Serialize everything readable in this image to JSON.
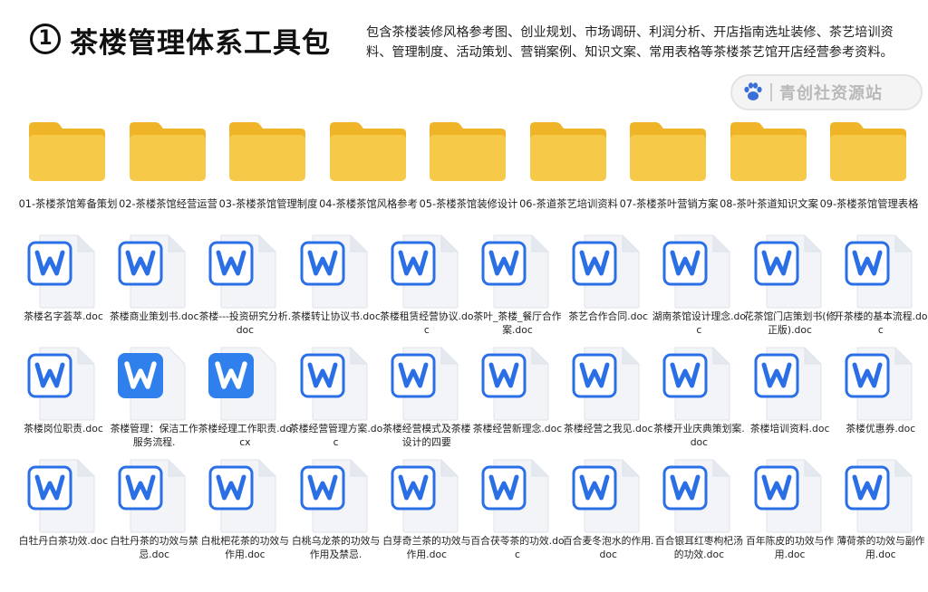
{
  "header": {
    "number": "1",
    "title": "茶楼管理体系工具包",
    "description": "包含茶楼装修风格参考图、创业规划、市场调研、利润分析、开店指南选址装修、茶艺培训资料、管理制度、活动策划、营销案例、知识文案、常用表格等茶楼茶艺馆开店经营参考资料。",
    "watermark": "青创社资源站"
  },
  "colors": {
    "folder": "#f7c948",
    "folder_dark": "#f0b429",
    "word_blue": "#2b6fe6",
    "word_tile": "#2f80ed"
  },
  "folders": [
    {
      "label": "01-茶楼茶馆筹备策划"
    },
    {
      "label": "02-茶楼茶馆经营运营"
    },
    {
      "label": "03-茶楼茶馆管理制度"
    },
    {
      "label": "04-茶楼茶馆风格参考"
    },
    {
      "label": "05-茶楼茶馆装修设计"
    },
    {
      "label": "06-茶道茶艺培训资料"
    },
    {
      "label": "07-茶楼茶叶营销方案"
    },
    {
      "label": "08-茶叶茶道知识文案"
    },
    {
      "label": "09-茶楼茶馆管理表格"
    }
  ],
  "docs": [
    {
      "label": "茶楼名字荟萃.doc",
      "style": "outline"
    },
    {
      "label": "茶楼商业策划书.doc",
      "style": "outline"
    },
    {
      "label": "茶楼---投资研究分析.doc",
      "style": "outline"
    },
    {
      "label": "茶楼转让协议书.doc",
      "style": "outline"
    },
    {
      "label": "茶楼租赁经营协议.doc",
      "style": "outline"
    },
    {
      "label": "茶叶_茶楼_餐厅合作案.doc",
      "style": "outline"
    },
    {
      "label": "茶艺合作合同.doc",
      "style": "outline"
    },
    {
      "label": "湖南茶馆设计理念.doc",
      "style": "outline"
    },
    {
      "label": "花茶馆门店策划书(修正版).doc",
      "style": "outline"
    },
    {
      "label": "开茶楼的基本流程.doc",
      "style": "outline"
    },
    {
      "label": "茶楼岗位职责.doc",
      "style": "outline"
    },
    {
      "label": "茶楼管理：保洁工作服务流程.",
      "style": "filled"
    },
    {
      "label": "茶楼经理工作职责.docx",
      "style": "filled"
    },
    {
      "label": "茶楼经营管理方案.doc",
      "style": "outline"
    },
    {
      "label": "茶楼经营模式及茶楼设计的四要",
      "style": "outline"
    },
    {
      "label": "茶楼经营新理念.doc",
      "style": "outline"
    },
    {
      "label": "茶楼经营之我见.doc",
      "style": "outline"
    },
    {
      "label": "茶楼开业庆典策划案.doc",
      "style": "outline"
    },
    {
      "label": "茶楼培训资料.doc",
      "style": "outline"
    },
    {
      "label": "茶楼优惠券.doc",
      "style": "outline"
    },
    {
      "label": "白牡丹白茶功效.doc",
      "style": "outline"
    },
    {
      "label": "白牡丹茶的功效与禁忌.doc",
      "style": "outline"
    },
    {
      "label": "白枇杷花茶的功效与作用.doc",
      "style": "outline"
    },
    {
      "label": "白桃乌龙茶的功效与作用及禁忌.",
      "style": "outline"
    },
    {
      "label": "白芽奇兰茶的功效与作用.doc",
      "style": "outline"
    },
    {
      "label": "百合茯苓茶的功效.doc",
      "style": "outline"
    },
    {
      "label": "百合麦冬泡水的作用.doc",
      "style": "outline"
    },
    {
      "label": "百合银耳红枣枸杞汤的功效.doc",
      "style": "outline"
    },
    {
      "label": "百年陈皮的功效与作用.doc",
      "style": "outline"
    },
    {
      "label": "薄荷茶的功效与副作用.doc",
      "style": "outline"
    }
  ]
}
